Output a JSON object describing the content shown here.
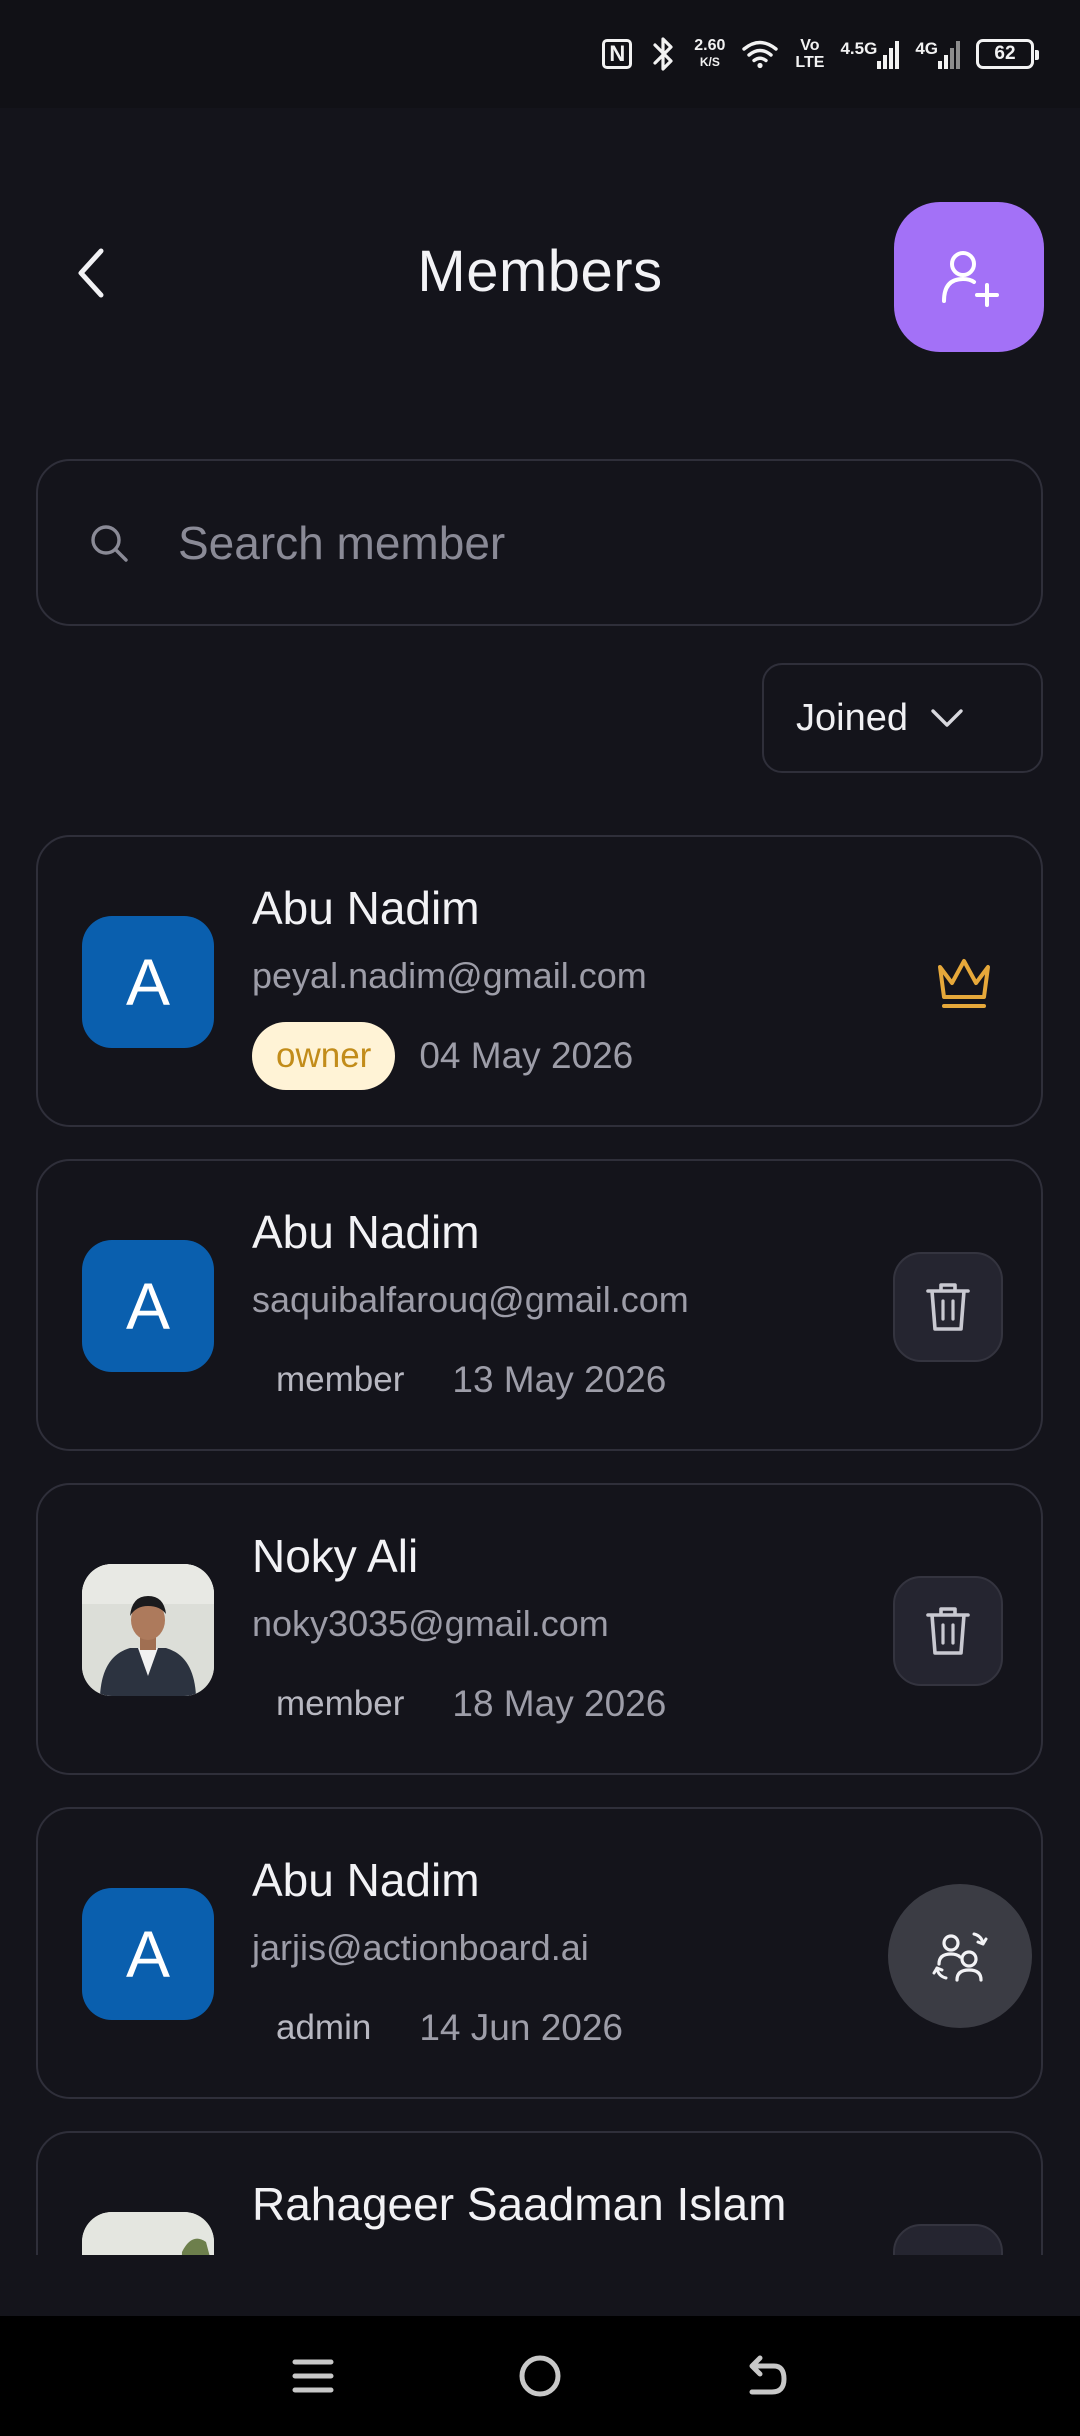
{
  "status_bar": {
    "nfc": "N",
    "speed_value": "2.60",
    "speed_unit": "K/S",
    "volte_top": "Vo",
    "volte_bottom": "LTE",
    "network_1": "4.5G",
    "network_2": "4G",
    "battery": "62"
  },
  "header": {
    "title": "Members"
  },
  "search": {
    "placeholder": "Search member",
    "value": ""
  },
  "sort": {
    "selected": "Joined"
  },
  "members": [
    {
      "name": "Abu Nadim",
      "email": "peyal.nadim@gmail.com",
      "role": "owner",
      "joined": "04 May 2026",
      "avatar_letter": "A"
    },
    {
      "name": "Abu Nadim",
      "email": "saquibalfarouq@gmail.com",
      "role": "member",
      "joined": "13 May 2026",
      "avatar_letter": "A"
    },
    {
      "name": "Noky Ali",
      "email": "noky3035@gmail.com",
      "role": "member",
      "joined": "18 May 2026",
      "avatar_letter": ""
    },
    {
      "name": "Abu Nadim",
      "email": "jarjis@actionboard.ai",
      "role": "admin",
      "joined": "14 Jun 2026",
      "avatar_letter": "A"
    },
    {
      "name": "Rahageer Saadman Islam",
      "email": "",
      "role": "",
      "joined": "",
      "avatar_letter": ""
    }
  ],
  "colors": {
    "background": "#14141b",
    "accent": "#a371f7",
    "avatar_blue": "#0a5fae",
    "owner_badge_bg": "#fff3d6",
    "owner_badge_text": "#c28c1a",
    "crown": "#e6a83a"
  }
}
